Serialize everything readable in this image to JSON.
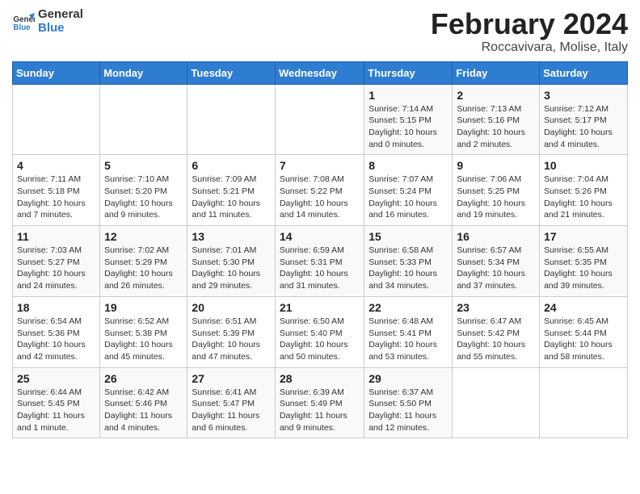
{
  "logo": {
    "text_general": "General",
    "text_blue": "Blue"
  },
  "title": {
    "month_year": "February 2024",
    "location": "Roccavivara, Molise, Italy"
  },
  "weekdays": [
    "Sunday",
    "Monday",
    "Tuesday",
    "Wednesday",
    "Thursday",
    "Friday",
    "Saturday"
  ],
  "weeks": [
    [
      {
        "day": "",
        "info": ""
      },
      {
        "day": "",
        "info": ""
      },
      {
        "day": "",
        "info": ""
      },
      {
        "day": "",
        "info": ""
      },
      {
        "day": "1",
        "info": "Sunrise: 7:14 AM\nSunset: 5:15 PM\nDaylight: 10 hours\nand 0 minutes."
      },
      {
        "day": "2",
        "info": "Sunrise: 7:13 AM\nSunset: 5:16 PM\nDaylight: 10 hours\nand 2 minutes."
      },
      {
        "day": "3",
        "info": "Sunrise: 7:12 AM\nSunset: 5:17 PM\nDaylight: 10 hours\nand 4 minutes."
      }
    ],
    [
      {
        "day": "4",
        "info": "Sunrise: 7:11 AM\nSunset: 5:18 PM\nDaylight: 10 hours\nand 7 minutes."
      },
      {
        "day": "5",
        "info": "Sunrise: 7:10 AM\nSunset: 5:20 PM\nDaylight: 10 hours\nand 9 minutes."
      },
      {
        "day": "6",
        "info": "Sunrise: 7:09 AM\nSunset: 5:21 PM\nDaylight: 10 hours\nand 11 minutes."
      },
      {
        "day": "7",
        "info": "Sunrise: 7:08 AM\nSunset: 5:22 PM\nDaylight: 10 hours\nand 14 minutes."
      },
      {
        "day": "8",
        "info": "Sunrise: 7:07 AM\nSunset: 5:24 PM\nDaylight: 10 hours\nand 16 minutes."
      },
      {
        "day": "9",
        "info": "Sunrise: 7:06 AM\nSunset: 5:25 PM\nDaylight: 10 hours\nand 19 minutes."
      },
      {
        "day": "10",
        "info": "Sunrise: 7:04 AM\nSunset: 5:26 PM\nDaylight: 10 hours\nand 21 minutes."
      }
    ],
    [
      {
        "day": "11",
        "info": "Sunrise: 7:03 AM\nSunset: 5:27 PM\nDaylight: 10 hours\nand 24 minutes."
      },
      {
        "day": "12",
        "info": "Sunrise: 7:02 AM\nSunset: 5:29 PM\nDaylight: 10 hours\nand 26 minutes."
      },
      {
        "day": "13",
        "info": "Sunrise: 7:01 AM\nSunset: 5:30 PM\nDaylight: 10 hours\nand 29 minutes."
      },
      {
        "day": "14",
        "info": "Sunrise: 6:59 AM\nSunset: 5:31 PM\nDaylight: 10 hours\nand 31 minutes."
      },
      {
        "day": "15",
        "info": "Sunrise: 6:58 AM\nSunset: 5:33 PM\nDaylight: 10 hours\nand 34 minutes."
      },
      {
        "day": "16",
        "info": "Sunrise: 6:57 AM\nSunset: 5:34 PM\nDaylight: 10 hours\nand 37 minutes."
      },
      {
        "day": "17",
        "info": "Sunrise: 6:55 AM\nSunset: 5:35 PM\nDaylight: 10 hours\nand 39 minutes."
      }
    ],
    [
      {
        "day": "18",
        "info": "Sunrise: 6:54 AM\nSunset: 5:36 PM\nDaylight: 10 hours\nand 42 minutes."
      },
      {
        "day": "19",
        "info": "Sunrise: 6:52 AM\nSunset: 5:38 PM\nDaylight: 10 hours\nand 45 minutes."
      },
      {
        "day": "20",
        "info": "Sunrise: 6:51 AM\nSunset: 5:39 PM\nDaylight: 10 hours\nand 47 minutes."
      },
      {
        "day": "21",
        "info": "Sunrise: 6:50 AM\nSunset: 5:40 PM\nDaylight: 10 hours\nand 50 minutes."
      },
      {
        "day": "22",
        "info": "Sunrise: 6:48 AM\nSunset: 5:41 PM\nDaylight: 10 hours\nand 53 minutes."
      },
      {
        "day": "23",
        "info": "Sunrise: 6:47 AM\nSunset: 5:42 PM\nDaylight: 10 hours\nand 55 minutes."
      },
      {
        "day": "24",
        "info": "Sunrise: 6:45 AM\nSunset: 5:44 PM\nDaylight: 10 hours\nand 58 minutes."
      }
    ],
    [
      {
        "day": "25",
        "info": "Sunrise: 6:44 AM\nSunset: 5:45 PM\nDaylight: 11 hours\nand 1 minute."
      },
      {
        "day": "26",
        "info": "Sunrise: 6:42 AM\nSunset: 5:46 PM\nDaylight: 11 hours\nand 4 minutes."
      },
      {
        "day": "27",
        "info": "Sunrise: 6:41 AM\nSunset: 5:47 PM\nDaylight: 11 hours\nand 6 minutes."
      },
      {
        "day": "28",
        "info": "Sunrise: 6:39 AM\nSunset: 5:49 PM\nDaylight: 11 hours\nand 9 minutes."
      },
      {
        "day": "29",
        "info": "Sunrise: 6:37 AM\nSunset: 5:50 PM\nDaylight: 11 hours\nand 12 minutes."
      },
      {
        "day": "",
        "info": ""
      },
      {
        "day": "",
        "info": ""
      }
    ]
  ]
}
